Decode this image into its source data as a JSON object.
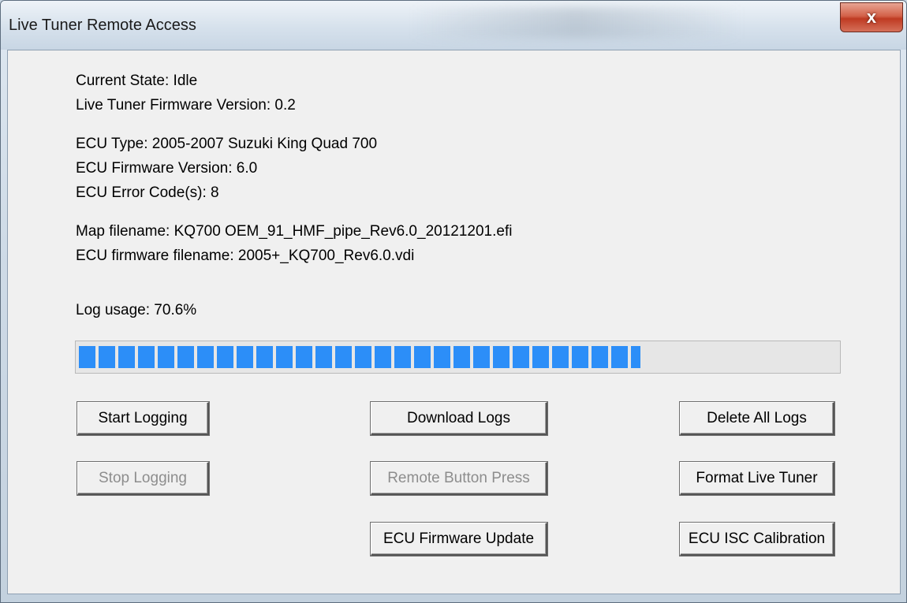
{
  "window": {
    "title": "Live Tuner Remote Access",
    "close_glyph": "x"
  },
  "status": {
    "current_state": "Current State: Idle",
    "live_tuner_firmware": "Live Tuner Firmware Version: 0.2",
    "ecu_type": "ECU Type: 2005-2007 Suzuki King Quad 700",
    "ecu_firmware_version": "ECU Firmware Version: 6.0",
    "ecu_error_codes": "ECU Error Code(s): 8",
    "map_filename": "Map filename: KQ700 OEM_91_HMF_pipe_Rev6.0_20121201.efi",
    "ecu_firmware_filename": "ECU firmware filename: 2005+_KQ700_Rev6.0.vdi"
  },
  "log": {
    "usage_label": "Log usage: 70.6%",
    "usage_fraction": 0.741
  },
  "buttons": {
    "start_logging": "Start Logging",
    "download_logs": "Download Logs",
    "delete_all_logs": "Delete All Logs",
    "stop_logging": "Stop Logging",
    "remote_button_press": "Remote Button Press",
    "format_live_tuner": "Format Live Tuner",
    "ecu_firmware_update": "ECU Firmware Update",
    "ecu_isc_calibration": "ECU ISC Calibration"
  },
  "colors": {
    "progress_fill": "#2c8ef8",
    "close_button": "#c8452c"
  },
  "icons": {
    "close": "close-icon"
  }
}
